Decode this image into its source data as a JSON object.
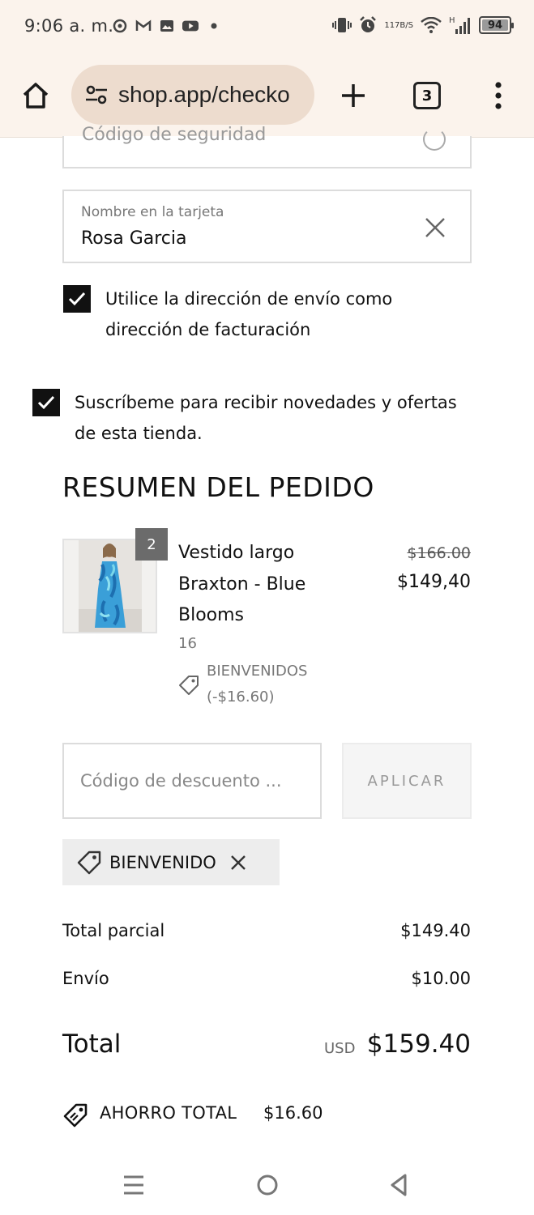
{
  "status_bar": {
    "time": "9:06 a. m.",
    "icons": [
      "shield-icon",
      "gmail-icon",
      "gallery-icon",
      "youtube-icon",
      "dot-icon"
    ],
    "net_speed_top": "117",
    "net_speed_bottom": "B/S",
    "signal_label": "H",
    "battery": "94"
  },
  "browser": {
    "url": "shop.app/checko",
    "tab_count": "3"
  },
  "card_form": {
    "name_label": "Nombre en la tarjeta",
    "name_value": "Rosa Garcia",
    "security_code_peek": "Código de seguridad"
  },
  "billing_checkbox": {
    "line1": "Utilice la dirección de envío como",
    "line2": "dirección de facturación"
  },
  "subscribe_checkbox": {
    "line1": "Suscríbeme para recibir novedades y ofertas",
    "line2": "de esta tienda."
  },
  "order_summary": {
    "title": "RESUMEN DEL PEDIDO",
    "item": {
      "quantity": "2",
      "name_line1": "Vestido largo",
      "name_line2": "Braxton - Blue",
      "name_line3": "Blooms",
      "variant": "16",
      "discount_code": "BIENVENIDOS",
      "discount_amount": "(-$16.60)",
      "price_original": "$166.00",
      "price_discounted": "$149,40"
    }
  },
  "discount": {
    "placeholder": "Código de descuento ...",
    "apply_label": "APLICAR",
    "applied_code": "BIENVENIDO"
  },
  "totals": {
    "subtotal_label": "Total parcial",
    "subtotal_value": "$149.40",
    "shipping_label": "Envío",
    "shipping_value": "$10.00",
    "total_label": "Total",
    "currency": "USD",
    "total_value": "$159.40",
    "savings_label": "AHORRO TOTAL",
    "savings_value": "$16.60"
  }
}
